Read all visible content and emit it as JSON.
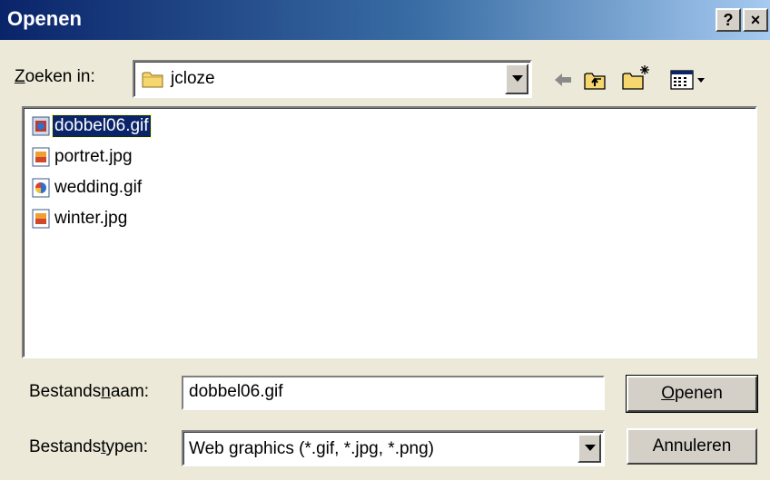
{
  "window": {
    "title": "Openen",
    "help_glyph": "?",
    "close_glyph": "×"
  },
  "lookin": {
    "label_u": "Z",
    "label_rest": "oeken in:",
    "folder": "jcloze",
    "folder_icon": "folder-icon"
  },
  "toolbar": {
    "icons": [
      "back-arrow-icon",
      "up-folder-icon",
      "new-folder-icon",
      "view-menu-icon"
    ]
  },
  "files": [
    {
      "name": "dobbel06.gif",
      "icon": "gif-image-icon",
      "selected": true
    },
    {
      "name": "portret.jpg",
      "icon": "jpg-image-icon",
      "selected": false
    },
    {
      "name": "wedding.gif",
      "icon": "gif-image-icon",
      "selected": false
    },
    {
      "name": "winter.jpg",
      "icon": "jpg-image-icon",
      "selected": false
    }
  ],
  "filename": {
    "label_pre": "Bestands",
    "label_u": "n",
    "label_post": "aam:",
    "value": "dobbel06.gif"
  },
  "filetype": {
    "label_pre": "Bestands",
    "label_u": "t",
    "label_post": "ypen:",
    "value": "Web graphics (*.gif, *.jpg, *.png)"
  },
  "buttons": {
    "open_u": "O",
    "open_rest": "penen",
    "cancel": "Annuleren"
  },
  "colors": {
    "titlebar_start": "#0a246a",
    "titlebar_end": "#a6caf0",
    "selection": "#0a246a",
    "face": "#ece9d8"
  }
}
